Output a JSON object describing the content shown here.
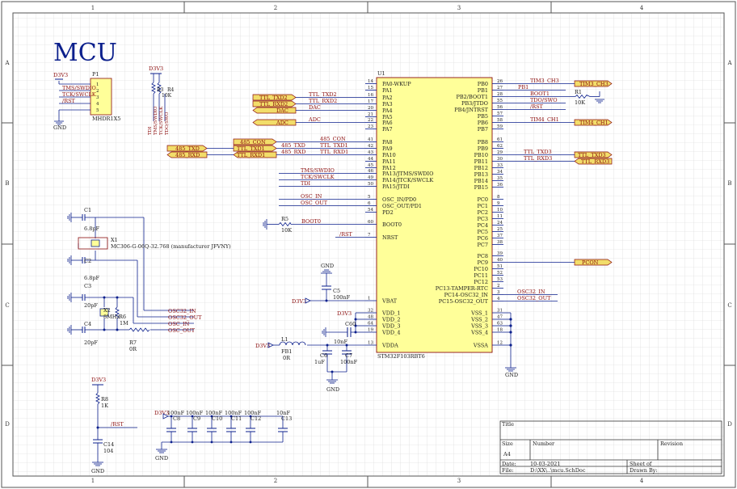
{
  "sheet": {
    "title": "MCU",
    "columns": [
      "1",
      "2",
      "3",
      "4"
    ],
    "rows": [
      "A",
      "B",
      "C",
      "D"
    ]
  },
  "mcu": {
    "designator": "U1",
    "part": "STM32F103RBT6",
    "left_pins": [
      {
        "num": "14",
        "name": "PA0-WKUP",
        "net": ""
      },
      {
        "num": "15",
        "name": "PA1",
        "net": ""
      },
      {
        "num": "16",
        "name": "PA2",
        "net": "TTL_TXD2"
      },
      {
        "num": "17",
        "name": "PA3",
        "net": "TTL_RXD2"
      },
      {
        "num": "20",
        "name": "PA4",
        "net": "DAC"
      },
      {
        "num": "21",
        "name": "PA5",
        "net": ""
      },
      {
        "num": "22",
        "name": "PA6",
        "net": "ADC"
      },
      {
        "num": "23",
        "name": "PA7",
        "net": ""
      },
      {
        "num": "41",
        "name": "PA8",
        "net": "485_CON"
      },
      {
        "num": "42",
        "name": "PA9",
        "net": "TTL_TXD1"
      },
      {
        "num": "43",
        "name": "PA10",
        "net": "TTL_RXD1"
      },
      {
        "num": "44",
        "name": "PA11",
        "net": ""
      },
      {
        "num": "45",
        "name": "PA12",
        "net": ""
      },
      {
        "num": "46",
        "name": "PA13/JTMS/SWDIO",
        "net": "TMS/SWDIO"
      },
      {
        "num": "49",
        "name": "PA14/JTCK/SWCLK",
        "net": "TCK/SWCLK"
      },
      {
        "num": "50",
        "name": "PA15/JTDI",
        "net": "TDI"
      },
      {
        "num": "5",
        "name": "OSC_IN/PD0",
        "net": "OSC_IN"
      },
      {
        "num": "6",
        "name": "OSC_OUT/PD1",
        "net": "OSC_OUT"
      },
      {
        "num": "54",
        "name": "PD2",
        "net": ""
      },
      {
        "num": "60",
        "name": "BOOT0",
        "net": "BOOT0"
      },
      {
        "num": "7",
        "name": "NRST",
        "net": "/RST"
      },
      {
        "num": "1",
        "name": "VBAT",
        "net": ""
      },
      {
        "num": "32",
        "name": "VDD_1",
        "net": ""
      },
      {
        "num": "48",
        "name": "VDD_2",
        "net": ""
      },
      {
        "num": "64",
        "name": "VDD_3",
        "net": ""
      },
      {
        "num": "19",
        "name": "VDD_4",
        "net": ""
      },
      {
        "num": "13",
        "name": "VDDA",
        "net": ""
      }
    ],
    "right_pins": [
      {
        "num": "26",
        "name": "PB0",
        "net": "TIM3_CH3"
      },
      {
        "num": "27",
        "name": "PB1",
        "net": "PB1"
      },
      {
        "num": "28",
        "name": "PB2/BOOT1",
        "net": "BOOT1"
      },
      {
        "num": "55",
        "name": "PB3/JTDO",
        "net": "TDO/SWO"
      },
      {
        "num": "56",
        "name": "PB4/JNTRST",
        "net": "/RST"
      },
      {
        "num": "57",
        "name": "PB5",
        "net": ""
      },
      {
        "num": "58",
        "name": "PB6",
        "net": "TIM4_CH1"
      },
      {
        "num": "59",
        "name": "PB7",
        "net": ""
      },
      {
        "num": "61",
        "name": "PB8",
        "net": ""
      },
      {
        "num": "62",
        "name": "PB9",
        "net": ""
      },
      {
        "num": "29",
        "name": "PB10",
        "net": "TTL_TXD3"
      },
      {
        "num": "30",
        "name": "PB11",
        "net": "TTL_RXD3"
      },
      {
        "num": "33",
        "name": "PB12",
        "net": ""
      },
      {
        "num": "34",
        "name": "PB13",
        "net": ""
      },
      {
        "num": "35",
        "name": "PB14",
        "net": ""
      },
      {
        "num": "36",
        "name": "PB15",
        "net": ""
      },
      {
        "num": "8",
        "name": "PC0",
        "net": ""
      },
      {
        "num": "9",
        "name": "PC1",
        "net": ""
      },
      {
        "num": "10",
        "name": "PC2",
        "net": ""
      },
      {
        "num": "11",
        "name": "PC3",
        "net": ""
      },
      {
        "num": "24",
        "name": "PC4",
        "net": ""
      },
      {
        "num": "25",
        "name": "PC5",
        "net": ""
      },
      {
        "num": "37",
        "name": "PC6",
        "net": ""
      },
      {
        "num": "38",
        "name": "PC7",
        "net": ""
      },
      {
        "num": "39",
        "name": "PC8",
        "net": ""
      },
      {
        "num": "40",
        "name": "PC9",
        "net": ""
      },
      {
        "num": "51",
        "name": "PC10",
        "net": ""
      },
      {
        "num": "52",
        "name": "PC11",
        "net": ""
      },
      {
        "num": "53",
        "name": "PC12",
        "net": ""
      },
      {
        "num": "2",
        "name": "PC13-TAMPER-RTC",
        "net": ""
      },
      {
        "num": "3",
        "name": "PC14-OSC32_IN",
        "net": "OSC32_IN"
      },
      {
        "num": "4",
        "name": "PC15-OSC32_OUT",
        "net": "OSC32_OUT"
      },
      {
        "num": "31",
        "name": "VSS_1",
        "net": ""
      },
      {
        "num": "47",
        "name": "VSS_2",
        "net": ""
      },
      {
        "num": "63",
        "name": "VSS_3",
        "net": ""
      },
      {
        "num": "18",
        "name": "VSS_4",
        "net": ""
      },
      {
        "num": "12",
        "name": "VSSA",
        "net": ""
      }
    ]
  },
  "ports": {
    "ttl_txd2": "TTL_TXD2",
    "ttl_rxd2": "TTL_RXD2",
    "dac": "DAC",
    "adc": "ADC",
    "c485_con": "485_CON",
    "ttl_txd1": "TTL_TXD1",
    "ttl_rxd1": "TTL_RXD1",
    "c485_txd": "485_TXD",
    "c485_rxd": "485_RXD",
    "tim3_ch3": "TIM3_CH3",
    "tim4_ch1": "TIM4_CH1",
    "ttl_txd3": "TTL_TXD3",
    "ttl_rxd3": "TTL_RXD3",
    "pcon": "PCON"
  },
  "nets": {
    "d3v3": "D3V3",
    "gnd": "GND",
    "tms": "TMS/SWDIO",
    "tck": "TCK/SWCLK",
    "rst": "/RST",
    "tdi": "TDI",
    "tdo": "TDO/SWO",
    "c485_txd_net": "485_TXD",
    "c485_rxd_net": "485_RXD",
    "osc32_in": "OSC32_IN",
    "osc32_out": "OSC32_OUT",
    "osc_in": "OSC_IN",
    "osc_out": "OSC_OUT",
    "boot0": "BOOT0"
  },
  "parts": {
    "p1": {
      "ref": "P1",
      "value": "MHDR1X5",
      "pins": [
        "1",
        "2",
        "3",
        "4",
        "5"
      ]
    },
    "r3": "R3",
    "r4": "R4",
    "r3r4_value": "10K",
    "r1": {
      "ref": "R1",
      "value": "10K"
    },
    "c1": {
      "ref": "C1",
      "value": "6.8pF"
    },
    "c2": {
      "ref": "C2",
      "value": "6.8pF"
    },
    "x1": {
      "ref": "X1",
      "value": "MC306-G-06Q-32.768 (manufacturer JFVNY)"
    },
    "c3": {
      "ref": "C3",
      "value": "20pF"
    },
    "c4": {
      "ref": "C4",
      "value": "20pF"
    },
    "x2": {
      "ref": "X2",
      "value": "8MHz"
    },
    "r6": {
      "ref": "R6",
      "value": "1M"
    },
    "r7": {
      "ref": "R7",
      "value": "0R"
    },
    "r5": {
      "ref": "R5",
      "value": "10K"
    },
    "c5": {
      "ref": "C5",
      "value": "100nF"
    },
    "c60": {
      "ref": "C60",
      "value": "10nF"
    },
    "l1": "L1",
    "fb1": {
      "ref": "FB1",
      "value": "0R"
    },
    "c6": {
      "ref": "C6",
      "value": "1uF"
    },
    "c7": {
      "ref": "C7",
      "value": "100nF"
    },
    "r8": {
      "ref": "R8",
      "value": "1K"
    },
    "c14": {
      "ref": "C14",
      "value": "104"
    },
    "c8": {
      "ref": "C8",
      "value": "100nF"
    },
    "c9": {
      "ref": "C9",
      "value": "100nF"
    },
    "c10": {
      "ref": "C10",
      "value": "100nF"
    },
    "c11": {
      "ref": "C11",
      "value": "100nF"
    },
    "c12": {
      "ref": "C12",
      "value": "100nF"
    },
    "c13": {
      "ref": "C13",
      "value": "10nF"
    }
  },
  "title_block": {
    "title_label": "Title",
    "size_label": "Size",
    "size_value": "A4",
    "number_label": "Number",
    "revision_label": "Revision",
    "date_label": "Date:",
    "date_value": "10-03-2021",
    "file_label": "File:",
    "file_value": "D:\\XX\\..\\mcu.SchDoc",
    "sheet_label": "Sheet  of",
    "drawn_label": "Drawn By:"
  },
  "colors": {
    "wire": "#0b1f8c",
    "part_line": "#8b0d0d",
    "component_fill": "#ffff99",
    "port_fill": "#f2dd6a",
    "frame": "#333333"
  }
}
